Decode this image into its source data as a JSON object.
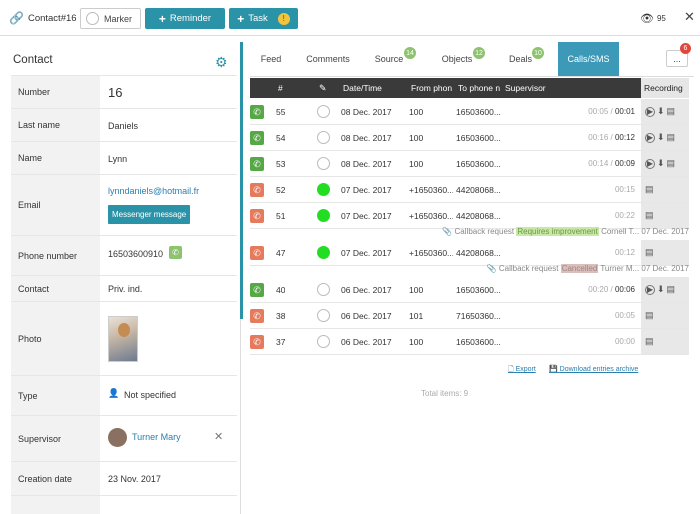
{
  "header": {
    "title": "Contact#16",
    "marker_label": "Marker",
    "reminder_label": "Reminder",
    "task_label": "Task",
    "task_badge": "!",
    "views_count": "95"
  },
  "contact": {
    "heading": "Contact",
    "fields": {
      "number": {
        "label": "Number",
        "value": "16"
      },
      "last_name": {
        "label": "Last name",
        "value": "Daniels"
      },
      "name": {
        "label": "Name",
        "value": "Lynn"
      },
      "email": {
        "label": "Email",
        "value": "lynndaniels@hotmail.fr",
        "button": "Messenger message"
      },
      "phone": {
        "label": "Phone number",
        "value": "16503600910"
      },
      "contact": {
        "label": "Contact",
        "value": "Priv. ind."
      },
      "photo": {
        "label": "Photo"
      },
      "type": {
        "label": "Type",
        "value": "Not specified"
      },
      "supervisor": {
        "label": "Supervisor",
        "value": "Turner Mary"
      },
      "creation_date": {
        "label": "Creation date",
        "value": "23 Nov. 2017"
      }
    }
  },
  "tabs": [
    {
      "label": "Feed"
    },
    {
      "label": "Comments"
    },
    {
      "label": "Source",
      "badge": "14"
    },
    {
      "label": "Objects",
      "badge": "12"
    },
    {
      "label": "Deals",
      "badge": "10"
    },
    {
      "label": "Calls/SMS"
    }
  ],
  "more_label": "...",
  "more_badge": "6",
  "table": {
    "headers": {
      "num": "#",
      "date": "Date/Time",
      "from": "From phon",
      "to": "To phone n",
      "supervisor": "Supervisor",
      "recording": "Recording"
    },
    "rows": [
      {
        "dir": "in",
        "id": "55",
        "date": "08 Dec. 2017",
        "from": "100",
        "to": "16503600...",
        "dur": "00:05",
        "dur2": "00:01",
        "status": "off"
      },
      {
        "dir": "in",
        "id": "54",
        "date": "08 Dec. 2017",
        "from": "100",
        "to": "16503600...",
        "dur": "00:16",
        "dur2": "00:12",
        "status": "off"
      },
      {
        "dir": "in",
        "id": "53",
        "date": "08 Dec. 2017",
        "from": "100",
        "to": "16503600...",
        "dur": "00:14",
        "dur2": "00:09",
        "status": "off"
      },
      {
        "dir": "out",
        "id": "52",
        "date": "07 Dec. 2017",
        "from": "+1650360...",
        "to": "44208068...",
        "dur": "00:15",
        "dur2": "",
        "status": "on"
      },
      {
        "dir": "out",
        "id": "51",
        "date": "07 Dec. 2017",
        "from": "+1650360...",
        "to": "44208068...",
        "dur": "00:22",
        "dur2": "",
        "status": "on"
      },
      {
        "dir": "out",
        "id": "47",
        "date": "07 Dec. 2017",
        "from": "+1650360...",
        "to": "44208068...",
        "dur": "00:12",
        "dur2": "",
        "status": "on"
      },
      {
        "dir": "in",
        "id": "40",
        "date": "06 Dec. 2017",
        "from": "100",
        "to": "16503600...",
        "dur": "00:20",
        "dur2": "00:06",
        "status": "off"
      },
      {
        "dir": "out",
        "id": "38",
        "date": "06 Dec. 2017",
        "from": "101",
        "to": "71650360...",
        "dur": "00:05",
        "dur2": "",
        "status": "off"
      },
      {
        "dir": "out",
        "id": "37",
        "date": "06 Dec. 2017",
        "from": "100",
        "to": "16503600...",
        "dur": "00:00",
        "dur2": "",
        "status": "off"
      }
    ],
    "sub_rows": [
      {
        "prefix": "Callback request",
        "tag": "Requires improvement",
        "who": "Cornell T...",
        "date": "07 Dec. 2017"
      },
      {
        "prefix": "Callback request",
        "tag": "Cancelled",
        "who": "Turner M...",
        "date": "07 Dec. 2017"
      }
    ],
    "export_label": "Export",
    "download_label": "Download entries archive",
    "total_label": "Total items: 9"
  },
  "colors": {
    "accent": "#2a93a8",
    "incoming": "#55a845",
    "outgoing": "#e67a5c",
    "active_status": "#22dd22"
  }
}
